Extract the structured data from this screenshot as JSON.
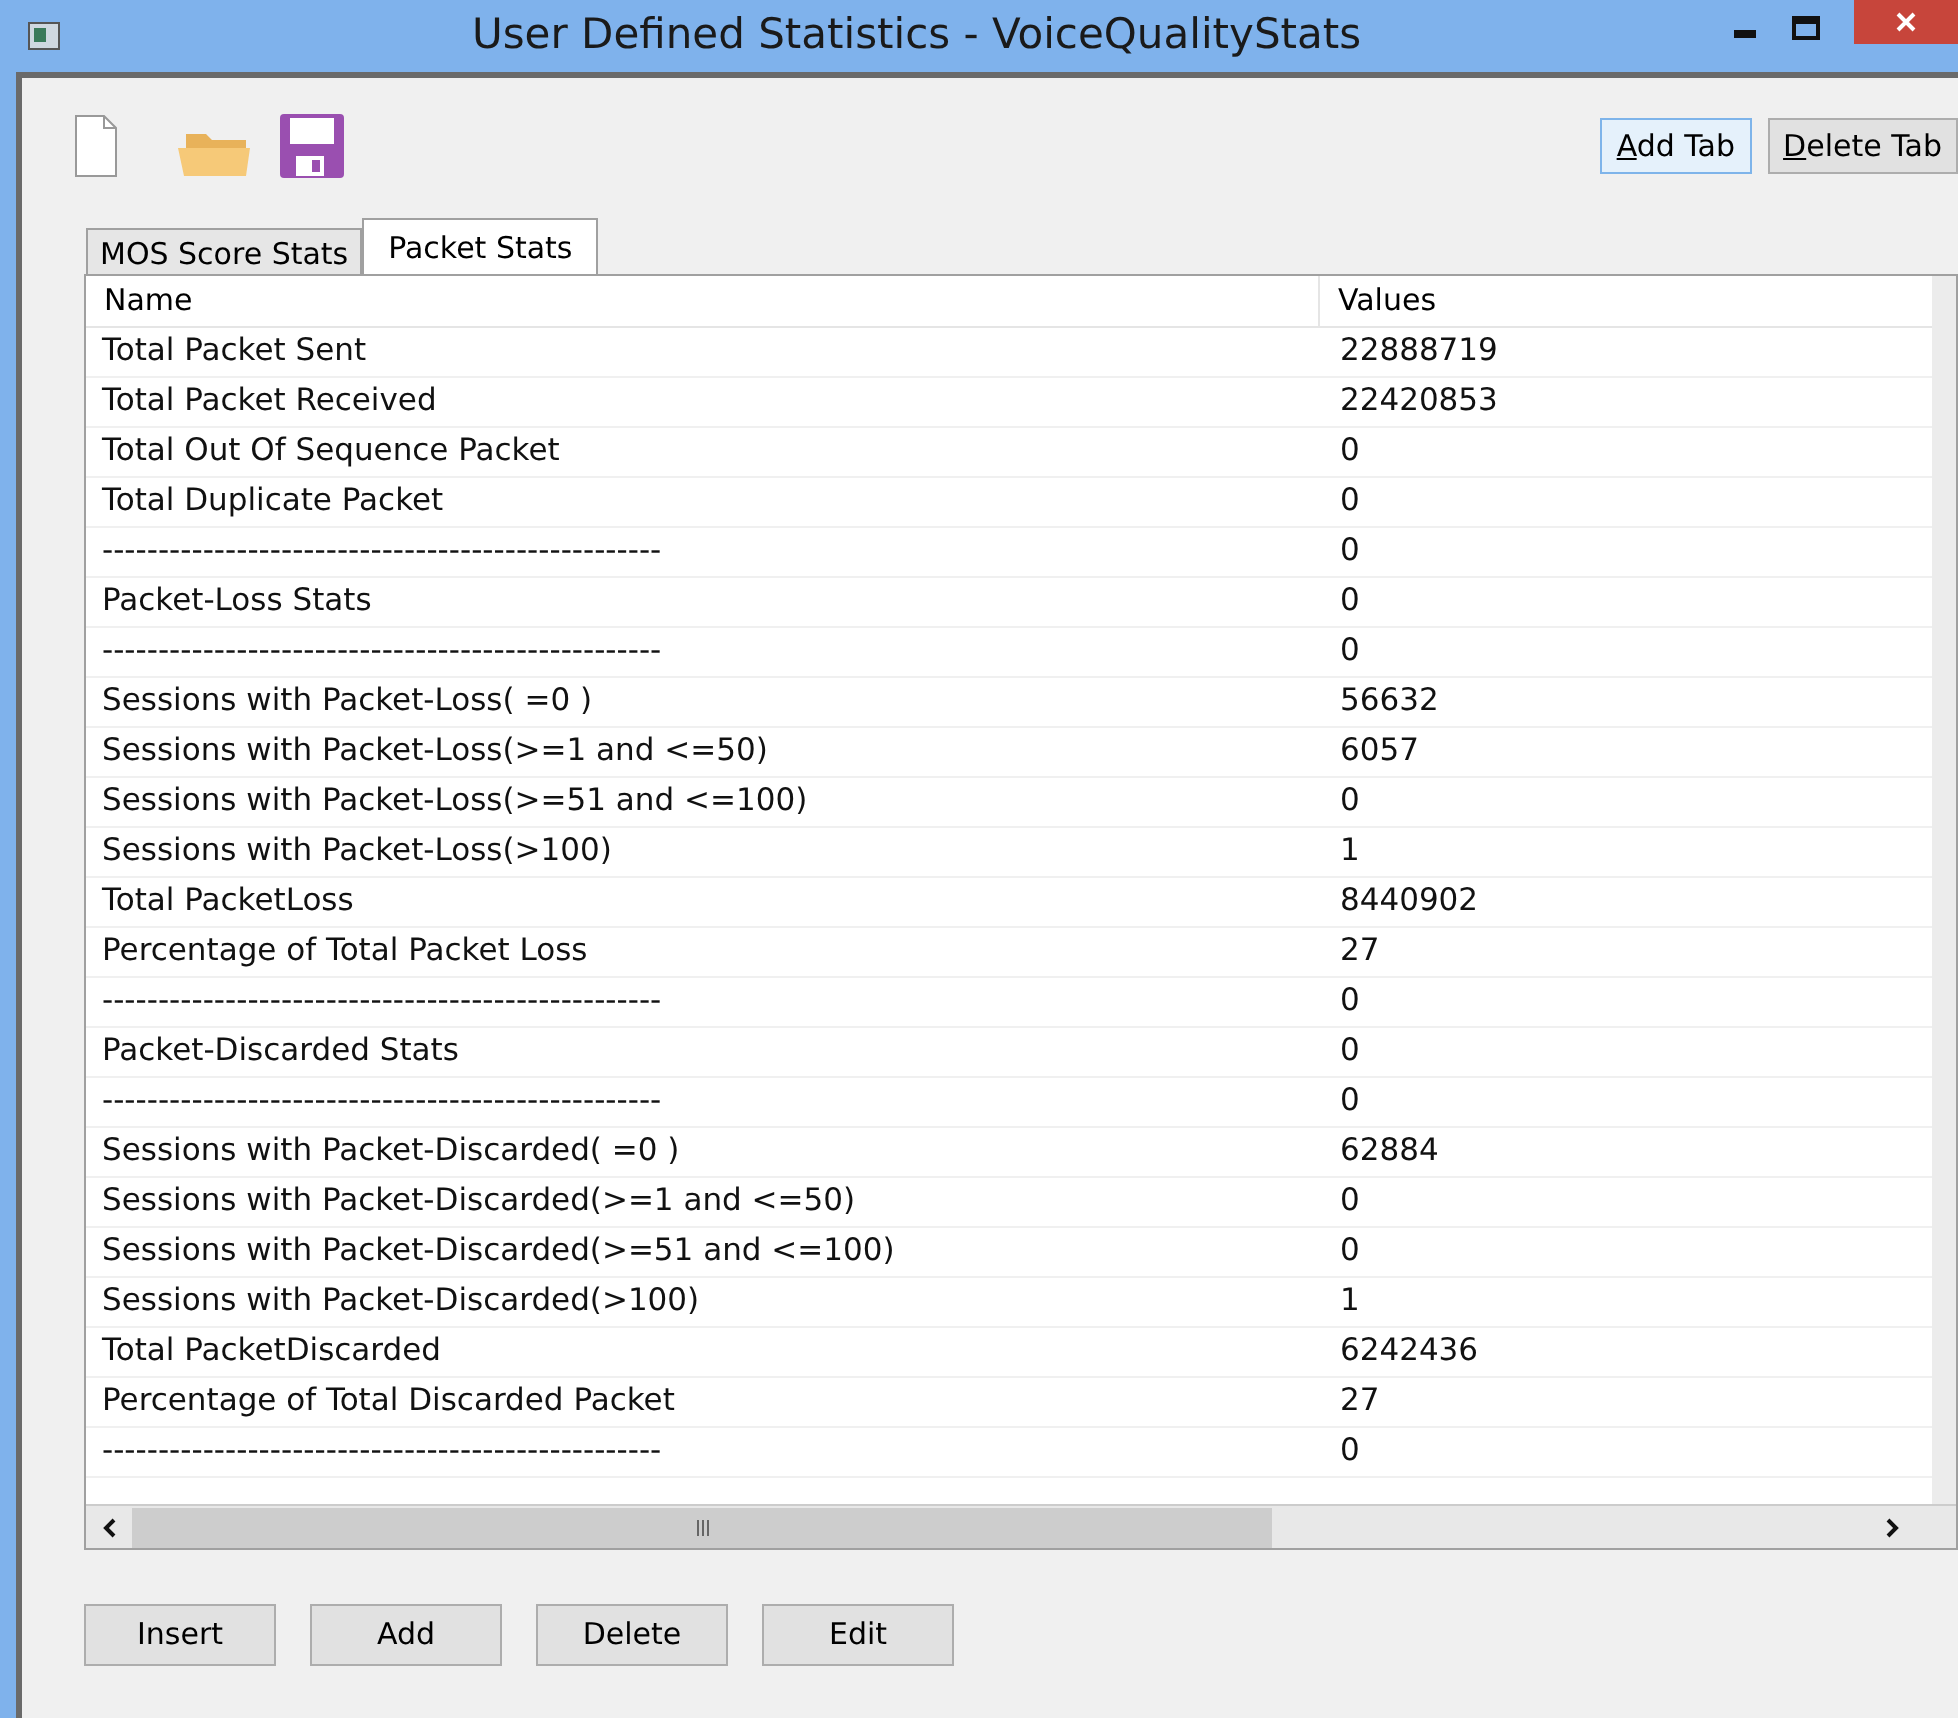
{
  "window": {
    "title": "User Defined Statistics - VoiceQualityStats"
  },
  "toolbar": {
    "buttons": [
      {
        "label": "Add Tab",
        "highlighted": true
      },
      {
        "label": "Delete Tab",
        "highlighted": false
      }
    ]
  },
  "tabs": [
    {
      "label": "MOS Score Stats",
      "selected": false
    },
    {
      "label": "Packet Stats",
      "selected": true
    }
  ],
  "table": {
    "columns": [
      "Name",
      "Values"
    ],
    "rows": [
      [
        "Total Packet Sent",
        "22888719"
      ],
      [
        "Total Packet Received",
        "22420853"
      ],
      [
        "Total Out Of Sequence Packet",
        "0"
      ],
      [
        "Total Duplicate Packet",
        "0"
      ],
      [
        "--------------------------------------------------",
        "0"
      ],
      [
        "Packet-Loss Stats",
        "0"
      ],
      [
        "--------------------------------------------------",
        "0"
      ],
      [
        "Sessions with Packet-Loss( =0 )",
        "56632"
      ],
      [
        "Sessions with Packet-Loss(>=1 and <=50)",
        "6057"
      ],
      [
        "Sessions with Packet-Loss(>=51 and <=100)",
        "0"
      ],
      [
        "Sessions with Packet-Loss(>100)",
        "1"
      ],
      [
        "Total PacketLoss",
        "8440902"
      ],
      [
        "Percentage of Total Packet Loss",
        "27"
      ],
      [
        "--------------------------------------------------",
        "0"
      ],
      [
        "Packet-Discarded Stats",
        "0"
      ],
      [
        "--------------------------------------------------",
        "0"
      ],
      [
        "Sessions with Packet-Discarded( =0 )",
        "62884"
      ],
      [
        "Sessions with Packet-Discarded(>=1 and <=50)",
        "0"
      ],
      [
        "Sessions with Packet-Discarded(>=51 and <=100)",
        "0"
      ],
      [
        "Sessions with Packet-Discarded(>100)",
        "1"
      ],
      [
        "Total PacketDiscarded",
        "6242436"
      ],
      [
        "Percentage of Total Discarded Packet",
        "27"
      ],
      [
        "--------------------------------------------------",
        "0"
      ]
    ]
  },
  "buttons": [
    "Insert",
    "Add",
    "Delete",
    "Edit"
  ]
}
